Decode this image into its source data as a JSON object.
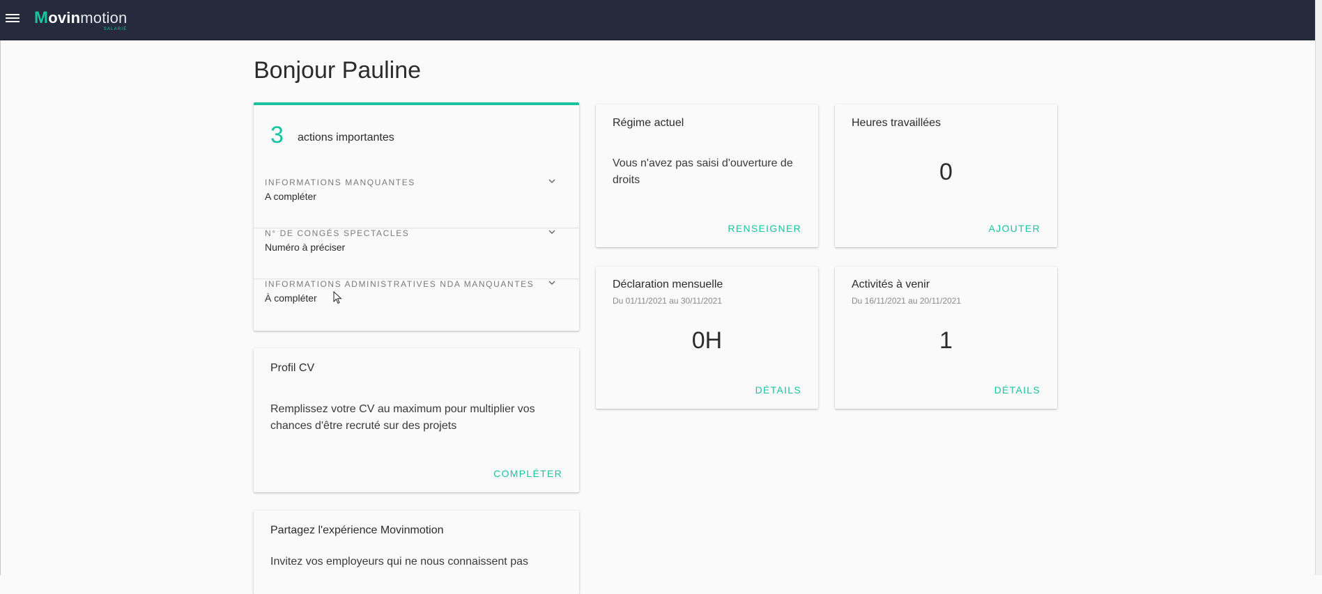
{
  "app": {
    "logo_mark": "M",
    "logo_bold": "ovin",
    "logo_thin": "motion",
    "logo_sub": "SALARIÉ"
  },
  "greeting": "Bonjour Pauline",
  "actions": {
    "count": "3",
    "label": "actions importantes",
    "items": [
      {
        "name": "Informations manquantes",
        "status": "A compléter"
      },
      {
        "name": "N° de congés spectacles",
        "status": "Numéro à préciser"
      },
      {
        "name": "Informations administratives NDA manquantes",
        "status": "À compléter"
      }
    ]
  },
  "profil_cv": {
    "title": "Profil CV",
    "text_line1": "Remplissez votre CV au maximum pour multiplier vos",
    "text_line2": "chances d'être recruté sur des projets",
    "action": "COMPLÉTER"
  },
  "partage": {
    "title": "Partagez l'expérience Movinmotion",
    "text_line1": "Invitez vos employeurs qui ne nous connaissent pas"
  },
  "regime": {
    "title": "Régime actuel",
    "text_line1": "Vous n'avez pas saisi d'ouverture de",
    "text_line2": "droits",
    "action": "RENSEIGNER"
  },
  "heures": {
    "title": "Heures travaillées",
    "value": "0",
    "action": "AJOUTER"
  },
  "declaration": {
    "title": "Déclaration mensuelle",
    "period": "Du 01/11/2021 au 30/11/2021",
    "value": "0H",
    "action": "DÉTAILS"
  },
  "activites": {
    "title": "Activités à venir",
    "period": "Du 16/11/2021 au 20/11/2021",
    "value": "1",
    "action": "DÉTAILS"
  },
  "colors": {
    "accent": "#19c3a0",
    "topbar": "#252b3c"
  }
}
